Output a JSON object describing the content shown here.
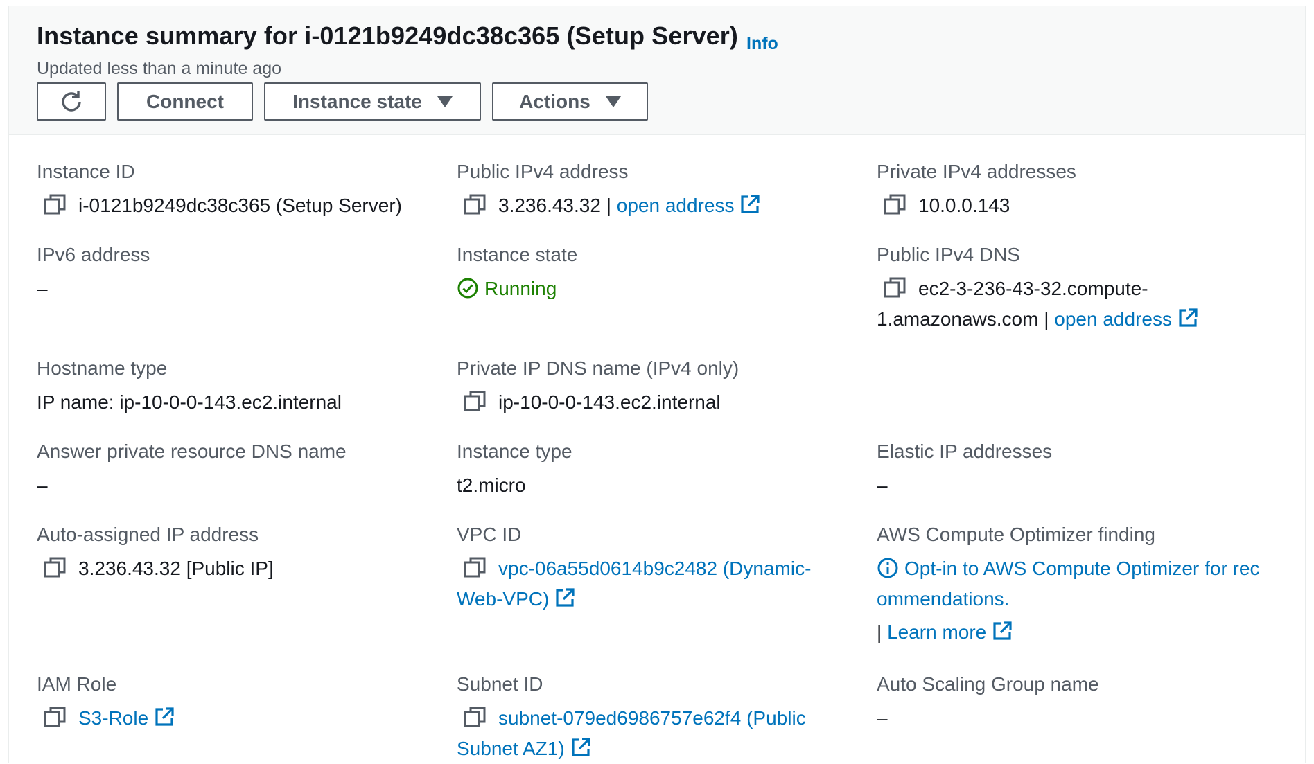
{
  "header": {
    "title": "Instance summary for i-0121b9249dc38c365 (Setup Server)",
    "info_link": "Info",
    "updated": "Updated less than a minute ago",
    "buttons": {
      "connect": "Connect",
      "instance_state": "Instance state",
      "actions": "Actions"
    }
  },
  "fields": {
    "instance_id": {
      "label": "Instance ID",
      "value": "i-0121b9249dc38c365 (Setup Server)"
    },
    "public_ipv4": {
      "label": "Public IPv4 address",
      "value": "3.236.43.32",
      "sep": "|",
      "link": "open address"
    },
    "private_ipv4": {
      "label": "Private IPv4 addresses",
      "value": "10.0.0.143"
    },
    "ipv6": {
      "label": "IPv6 address",
      "value": "–"
    },
    "instance_state": {
      "label": "Instance state",
      "value": "Running"
    },
    "public_dns": {
      "label": "Public IPv4 DNS",
      "value_line1": "ec2-3-236-43-32.compute-",
      "value_line2": "1.amazonaws.com",
      "sep": "|",
      "link": "open address"
    },
    "hostname_type": {
      "label": "Hostname type",
      "value": "IP name: ip-10-0-0-143.ec2.internal"
    },
    "private_dns": {
      "label": "Private IP DNS name (IPv4 only)",
      "value": "ip-10-0-0-143.ec2.internal"
    },
    "answer_dns": {
      "label": "Answer private resource DNS name",
      "value": "–"
    },
    "instance_type": {
      "label": "Instance type",
      "value": "t2.micro"
    },
    "elastic_ip": {
      "label": "Elastic IP addresses",
      "value": "–"
    },
    "auto_ip": {
      "label": "Auto-assigned IP address",
      "value": "3.236.43.32 [Public IP]"
    },
    "vpc_id": {
      "label": "VPC ID",
      "value_line1": "vpc-06a55d0614b9c2482 (Dynamic-",
      "value_line2": "Web-VPC)"
    },
    "optimizer": {
      "label": "AWS Compute Optimizer finding",
      "value_line1": "Opt-in to AWS Compute Optimizer for rec",
      "value_line2": "ommendations.",
      "sep": "|",
      "link": "Learn more"
    },
    "iam_role": {
      "label": "IAM Role",
      "value": "S3-Role"
    },
    "subnet_id": {
      "label": "Subnet ID",
      "value_line1": "subnet-079ed6986757e62f4 (Public",
      "value_line2": "Subnet AZ1)"
    },
    "asg_name": {
      "label": "Auto Scaling Group name",
      "value": "–"
    }
  },
  "colors": {
    "link": "#0073bb",
    "running": "#1d8102",
    "label": "#545b64",
    "text": "#16191f"
  }
}
